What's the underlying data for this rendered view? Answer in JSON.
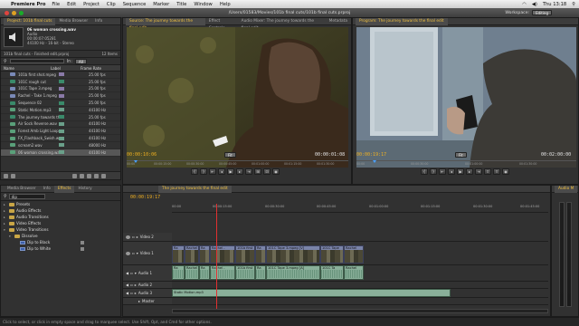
{
  "menubar": {
    "app_name": "Premiere Pro",
    "items": [
      "File",
      "Edit",
      "Project",
      "Clip",
      "Sequence",
      "Marker",
      "Title",
      "Window",
      "Help"
    ],
    "clock": "Thu 13:18",
    "apple_glyph": ""
  },
  "window": {
    "title": "/Users/01583/Movies/101b final cuts/101b final cuts.prproj",
    "workspace_label": "Workspace:",
    "workspace_value": "Editing"
  },
  "project": {
    "tabs": [
      "Project: 101b final cuts",
      "Media Browser",
      "Info"
    ],
    "clip_name": "06 woman crossing.wav",
    "clip_type": "Audio",
    "clip_duration": "00:00:07:05281",
    "clip_format": "44100 Hz - 16-bit - Stereo",
    "path": "101b final cuts - Finished edit.prproj",
    "item_count": "12 Items",
    "search_label": "In:",
    "search_value": "All",
    "columns": [
      "Name",
      "Label",
      "Frame Rate"
    ],
    "items": [
      {
        "name": "101b first shot.mpeg",
        "rate": "25.00 fps",
        "icon": "#7a8ab8",
        "label": "#8a7aa8"
      },
      {
        "name": "101C rough cut",
        "rate": "25.00 fps",
        "icon": "#3a8a6a",
        "label": "#3a8a6a"
      },
      {
        "name": "101C Tape 3.mpeg",
        "rate": "25.00 fps",
        "icon": "#7a8ab8",
        "label": "#8a7aa8"
      },
      {
        "name": "Rachel - Take 1.mpeg",
        "rate": "25.00 fps",
        "icon": "#7a8ab8",
        "label": "#8a7aa8"
      },
      {
        "name": "Sequence 02",
        "rate": "25.00 fps",
        "icon": "#3a8a6a",
        "label": "#3a8a6a"
      },
      {
        "name": "Static Motion.mp3",
        "rate": "44100 Hz",
        "icon": "#5aa07a",
        "label": "#6aa08a"
      },
      {
        "name": "The journey towards the",
        "rate": "25.00 fps",
        "icon": "#3a8a6a",
        "label": "#3a8a6a"
      },
      {
        "name": "Air Sock Reverse.wav",
        "rate": "44100 Hz",
        "icon": "#5aa07a",
        "label": "#6aa08a"
      },
      {
        "name": "Forest Amb Light Loop.w",
        "rate": "44100 Hz",
        "icon": "#5aa07a",
        "label": "#6aa08a"
      },
      {
        "name": "FX_Flashback_Swish.wav",
        "rate": "44100 Hz",
        "icon": "#5aa07a",
        "label": "#6aa08a"
      },
      {
        "name": "scream2.wav",
        "rate": "48000 Hz",
        "icon": "#5aa07a",
        "label": "#6aa08a"
      },
      {
        "name": "06 woman crossing.wav",
        "rate": "44100 Hz",
        "icon": "#5aa07a",
        "label": "#6aa08a"
      }
    ]
  },
  "source": {
    "title": "Source: The journey towards the final edit",
    "tabs": [
      "Effect Controls",
      "Audio Mixer: The journey towards the final edit",
      "Metadata"
    ],
    "timecode_in": "00:00:10:06",
    "timecode_out": "00:00:01:08",
    "zoom": "Fit",
    "ruler": [
      "00:00",
      "00:00:15:00",
      "00:00:30:00",
      "00:00:45:00",
      "00:01:00:00",
      "00:01:15:00",
      "00:01:30:00"
    ]
  },
  "program": {
    "title": "Program: The journey towards the final edit",
    "timecode_in": "00:00:19:17",
    "timecode_out": "00:02:00:00",
    "zoom": "Fit",
    "ruler": [
      "00:00",
      "00:00:30:00",
      "00:01:00:00",
      "00:01:30:00"
    ]
  },
  "effects": {
    "tabs": [
      "Media Browser",
      "Info",
      "Effects",
      "History"
    ],
    "search_value": "dip",
    "items": [
      {
        "label": "Presets",
        "level": 0,
        "type": "folder",
        "open": false
      },
      {
        "label": "Audio Effects",
        "level": 0,
        "type": "folder",
        "open": false
      },
      {
        "label": "Audio Transitions",
        "level": 0,
        "type": "folder",
        "open": false
      },
      {
        "label": "Video Effects",
        "level": 0,
        "type": "folder",
        "open": false
      },
      {
        "label": "Video Transitions",
        "level": 0,
        "type": "folder",
        "open": true
      },
      {
        "label": "Dissolve",
        "level": 1,
        "type": "folder",
        "open": true
      },
      {
        "label": "Dip to Black",
        "level": 2,
        "type": "fx",
        "open": false
      },
      {
        "label": "Dip to White",
        "level": 2,
        "type": "fx",
        "open": false
      }
    ]
  },
  "timeline": {
    "tab": "The journey towards the final edit",
    "timecode": "00:00:19:17",
    "ruler": [
      "00:00",
      "00:00:15:00",
      "00:00:30:00",
      "00:00:45:00",
      "00:01:00:00",
      "00:01:15:00",
      "00:01:30:00",
      "00:01:45:00"
    ],
    "tracks": {
      "video2": "Video 2",
      "video1": "Video 1",
      "audio1": "Audio 1",
      "audio2": "Audio 2",
      "audio3": "Audio 3",
      "master": "Master"
    },
    "video_clips": [
      "Ra",
      "Rachel",
      "Ra",
      "Rachel -",
      "101b first",
      "Ra",
      "101C Tape 3.mpeg [V]",
      "101C Tape",
      "Rachel"
    ],
    "audio_clips": [
      "Ra",
      "Rachel",
      "Ra",
      "Rachel -",
      "101b first",
      "Ra",
      "101C Tape 3.mpeg [A]",
      "101C Ta",
      "Rachel"
    ],
    "audio3_clip": "Static Motion.mp3"
  },
  "meters": {
    "tab": "Audio M"
  },
  "status_bar": "Click to select, or click in empty space and drag to marquee select. Use Shift, Opt, and Cmd for other options."
}
